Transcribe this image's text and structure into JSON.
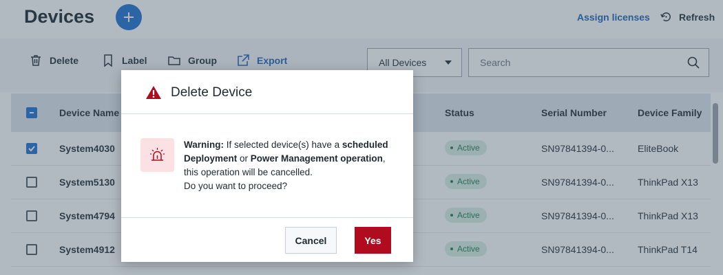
{
  "header": {
    "title": "Devices",
    "add_icon": "plus-icon",
    "assign_licenses": "Assign licenses",
    "refresh": "Refresh"
  },
  "toolbar": {
    "delete": "Delete",
    "label": "Label",
    "group": "Group",
    "export": "Export",
    "filter_value": "All Devices",
    "search_placeholder": "Search"
  },
  "table": {
    "columns": {
      "device_name": "Device Name",
      "status": "Status",
      "serial_number": "Serial Number",
      "device_family": "Device Family"
    },
    "header_checkbox": "indeterminate",
    "rows": [
      {
        "name": "System4030",
        "status": "Active",
        "serial": "SN97841394-0...",
        "family": "EliteBook",
        "checked": true
      },
      {
        "name": "System5130",
        "status": "Active",
        "serial": "SN97841394-0...",
        "family": "ThinkPad X13",
        "checked": false
      },
      {
        "name": "System4794",
        "status": "Active",
        "serial": "SN97841394-0...",
        "family": "ThinkPad X13",
        "checked": false
      },
      {
        "name": "System4912",
        "status": "Active",
        "serial": "SN97841394-0...",
        "family": "ThinkPad T14",
        "checked": false
      }
    ]
  },
  "dialog": {
    "title": "Delete Device",
    "warning_label": "Warning:",
    "text_1": " If selected device(s) have a ",
    "bold_1": "scheduled Deployment",
    "text_2": " or ",
    "bold_2": "Power Management operation",
    "text_3": ", this operation will be cancelled.",
    "question": "Do you want to proceed?",
    "cancel": "Cancel",
    "confirm": "Yes"
  },
  "colors": {
    "accent": "#1a6fd0",
    "danger": "#b00b1e",
    "status_active_bg": "#d8efe3",
    "status_active_text": "#1f7a4b"
  }
}
